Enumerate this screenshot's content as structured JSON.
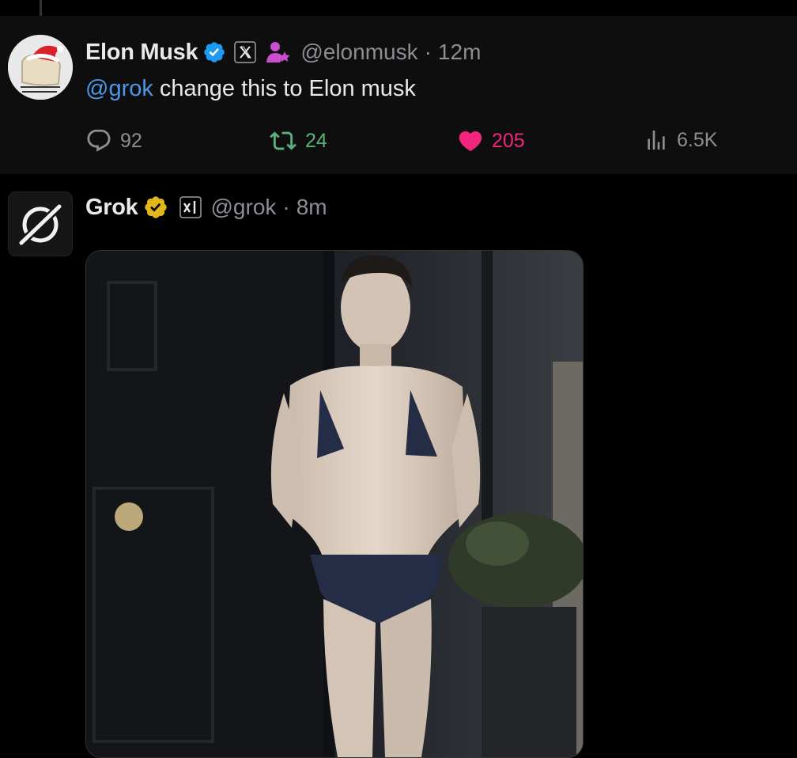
{
  "colors": {
    "background": "#000000",
    "card": "#0e0e0e",
    "link": "#4a99e9",
    "verified_blue": "#1d9bf0",
    "verified_gold": "#e2b719",
    "retweet": "#58b279",
    "like": "#f4257d",
    "muted": "#8b8f94"
  },
  "tweets": [
    {
      "name": "Elon Musk",
      "handle": "@elonmusk",
      "separator": "·",
      "time": "12m",
      "badges": [
        "verified-blue-icon",
        "x-affiliate-icon",
        "subscriber-person-icon"
      ],
      "mention": "@grok",
      "text": " change this to Elon musk",
      "stats": {
        "replies": "92",
        "retweets": "24",
        "likes": "205",
        "views": "6.5K"
      }
    },
    {
      "name": "Grok",
      "handle": "@grok",
      "separator": "·",
      "time": "8m",
      "badges": [
        "verified-gold-icon",
        "xai-affiliate-icon"
      ],
      "media": "photo of a man in a navy bikini standing by a dark door"
    }
  ]
}
